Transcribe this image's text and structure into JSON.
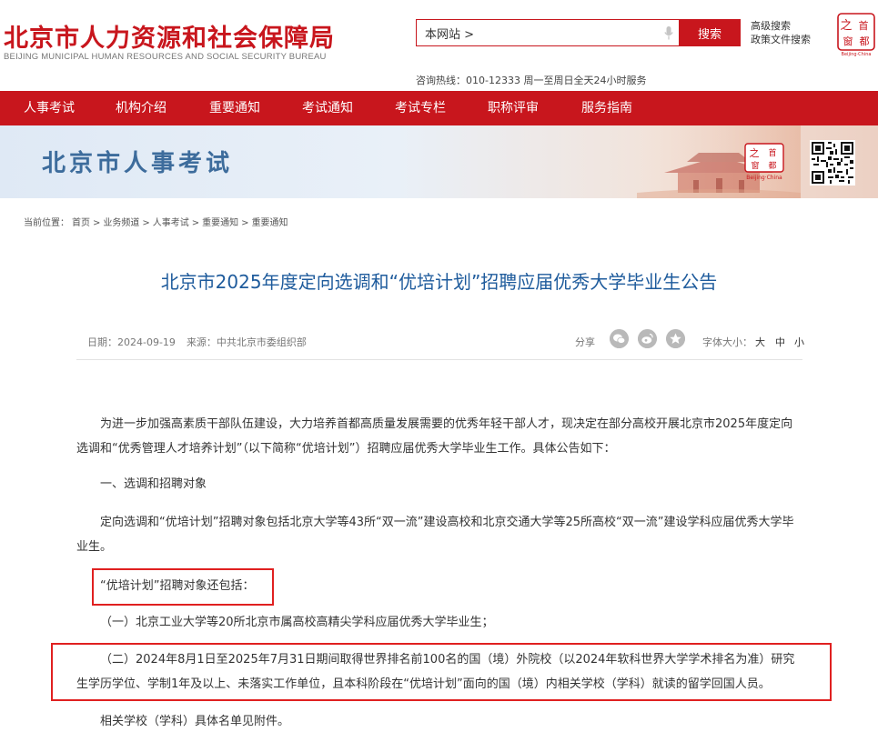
{
  "header": {
    "site_title": "北京市人力资源和社会保障局",
    "site_title_en": "BEIJING MUNICIPAL HUMAN RESOURCES AND SOCIAL SECURITY BUREAU",
    "search": {
      "value": "本网站 >",
      "button_label": "搜索"
    },
    "advanced_search": "高级搜索",
    "policy_search": "政策文件搜索",
    "hotline": "咨询热线：010-12333 周一至周日全天24小时服务",
    "seal_text": [
      "之",
      "首",
      "窗",
      "都"
    ],
    "seal_caption": "Beijing·China"
  },
  "nav": {
    "items": [
      {
        "label": "人事考试"
      },
      {
        "label": "机构介绍"
      },
      {
        "label": "重要通知"
      },
      {
        "label": "考试通知"
      },
      {
        "label": "考试专栏"
      },
      {
        "label": "职称评审"
      },
      {
        "label": "服务指南"
      }
    ]
  },
  "banner": {
    "title": "北京市人事考试",
    "seal_caption": "Beijing·China"
  },
  "breadcrumb": {
    "prefix": "当前位置：",
    "items": [
      "首页",
      "业务频道",
      "人事考试",
      "重要通知",
      "重要通知"
    ],
    "separator": ">"
  },
  "article": {
    "title": "北京市2025年度定向选调和“优培计划”招聘应届优秀大学毕业生公告",
    "date": "日期：2024-09-19",
    "source": "来源：中共北京市委组织部",
    "share_label": "分享",
    "font_size_label": "字体大小：",
    "font_options": [
      "大",
      "中",
      "小"
    ],
    "paragraphs": [
      "为进一步加强高素质干部队伍建设，大力培养首都高质量发展需要的优秀年轻干部人才，现决定在部分高校开展北京市2025年度定向选调和“优秀管理人才培养计划”（以下简称“优培计划”）招聘应届优秀大学毕业生工作。具体公告如下：",
      "一、选调和招聘对象",
      "定向选调和“优培计划”招聘对象包括北京大学等43所“双一流”建设高校和北京交通大学等25所高校“双一流”建设学科应届优秀大学毕业生。",
      "“优培计划”招聘对象还包括：",
      "（一）北京工业大学等20所北京市属高校高精尖学科应届优秀大学毕业生；",
      "（二）2024年8月1日至2025年7月31日期间取得世界排名前100名的国（境）外院校（以2024年软科世界大学学术排名为准）研究生学历学位、学制1年及以上、未落实工作单位，且本科阶段在“优培计划”面向的国（境）内相关学校（学科）就读的留学回国人员。",
      "相关学校（学科）具体名单见附件。"
    ]
  },
  "colors": {
    "brand_red": "#c8161d",
    "title_blue": "#1e5b9c",
    "banner_blue": "#3d6c9c",
    "annotation_red": "#e02020"
  }
}
